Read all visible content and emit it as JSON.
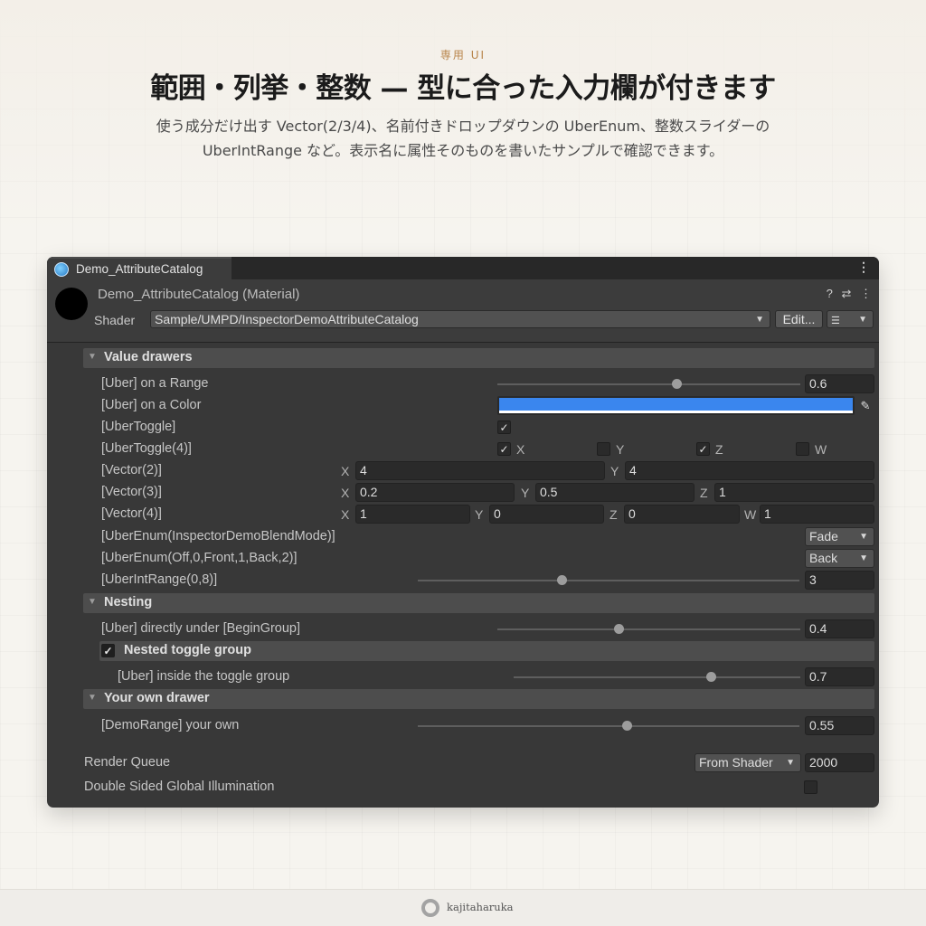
{
  "hero": {
    "eyebrow": "専用 UI",
    "headline": "範囲・列挙・整数 — 型に合った入力欄が付きます",
    "subtitle": "使う成分だけ出す Vector(2/3/4)、名前付きドロップダウンの UberEnum、整数スライダーの UberIntRange など。表示名に属性そのものを書いたサンプルで確認できます。"
  },
  "window": {
    "tab_title": "Demo_AttributeCatalog",
    "material_title": "Demo_AttributeCatalog (Material)",
    "shader_label": "Shader",
    "shader_value": "Sample/UMPD/InspectorDemoAttributeCatalog",
    "edit_button": "Edit..."
  },
  "sections": {
    "value_drawers": "Value drawers",
    "nesting": "Nesting",
    "nested_toggle_group": "Nested toggle group",
    "own_drawer": "Your own drawer"
  },
  "rows": {
    "range": {
      "label": "[Uber]  on a Range",
      "value": "0.6",
      "fraction": 0.6
    },
    "color": {
      "label": "[Uber]  on a Color",
      "color": "#3a86ee"
    },
    "toggle": {
      "label": "[UberToggle]",
      "checked": true
    },
    "toggle4": {
      "label": "[UberToggle(4)]",
      "items": [
        {
          "axis": "X",
          "checked": true
        },
        {
          "axis": "Y",
          "checked": false
        },
        {
          "axis": "Z",
          "checked": true
        },
        {
          "axis": "W",
          "checked": false
        }
      ]
    },
    "vector2": {
      "label": "[Vector(2)]",
      "axes": [
        "X",
        "Y"
      ],
      "values": [
        "4",
        "4"
      ]
    },
    "vector3": {
      "label": "[Vector(3)]",
      "axes": [
        "X",
        "Y",
        "Z"
      ],
      "values": [
        "0.2",
        "0.5",
        "1"
      ]
    },
    "vector4": {
      "label": "[Vector(4)]",
      "axes": [
        "X",
        "Y",
        "Z",
        "W"
      ],
      "values": [
        "1",
        "0",
        "0",
        "1"
      ]
    },
    "enum_blend": {
      "label": "[UberEnum(InspectorDemoBlendMode)]",
      "value": "Fade"
    },
    "enum_cull": {
      "label": "[UberEnum(Off,0,Front,1,Back,2)]",
      "value": "Back"
    },
    "int_range": {
      "label": "[UberIntRange(0,8)]",
      "value": "3",
      "fraction": 0.375
    },
    "nest_range": {
      "label": "[Uber]  directly under [BeginGroup]",
      "value": "0.4",
      "fraction": 0.4
    },
    "toggle_group_range": {
      "label": "[Uber]  inside the toggle group",
      "value": "0.7",
      "fraction": 0.7
    },
    "demo_range": {
      "label": "[DemoRange]  your own",
      "value": "0.55",
      "fraction": 0.55
    }
  },
  "bottom": {
    "render_queue_label": "Render Queue",
    "render_queue_mode": "From Shader",
    "render_queue_value": "2000",
    "dsgi_label": "Double Sided Global Illumination",
    "dsgi_checked": false
  },
  "footer": {
    "brand": "kajitaharuka"
  }
}
